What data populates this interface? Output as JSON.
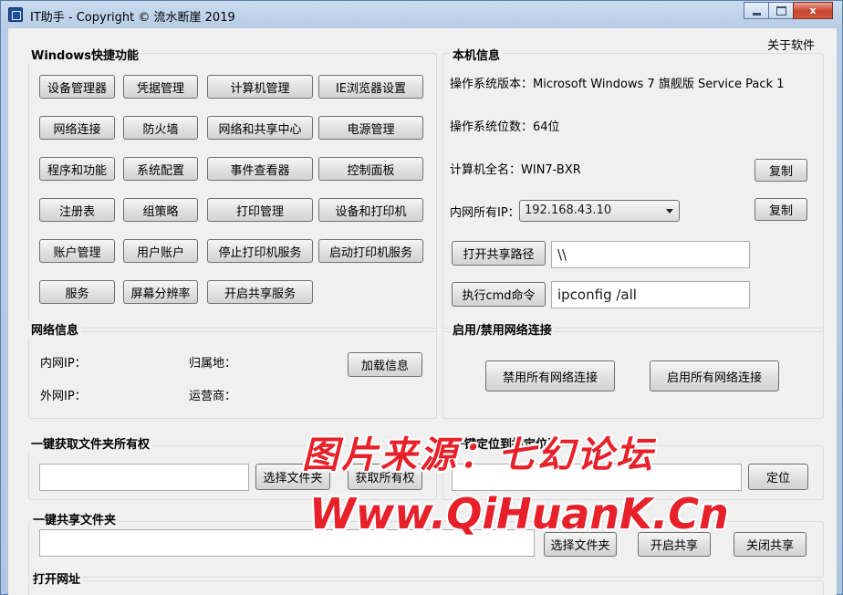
{
  "window": {
    "title": "IT助手 - Copyright © 流水断崖 2019",
    "close_glyph": "x"
  },
  "about_link": "关于软件",
  "shortcuts": {
    "title": "Windows快捷功能",
    "buttons": [
      "设备管理器",
      "凭据管理",
      "计算机管理",
      "IE浏览器设置",
      "网络连接",
      "防火墙",
      "网络和共享中心",
      "电源管理",
      "程序和功能",
      "系统配置",
      "事件查看器",
      "控制面板",
      "注册表",
      "组策略",
      "打印管理",
      "设备和打印机",
      "账户管理",
      "用户账户",
      "停止打印机服务",
      "启动打印机服务",
      "服务",
      "屏幕分辨率",
      "开启共享服务"
    ]
  },
  "local_info": {
    "title": "本机信息",
    "os_version": "操作系统版本：Microsoft Windows 7 旗舰版  Service Pack 1",
    "os_bits": "操作系统位数：64位",
    "computer_name": "计算机全名：WIN7-BXR",
    "copy_label": "复制",
    "lan_ip_label": "内网所有IP：",
    "lan_ip_value": "192.168.43.10",
    "open_share_label": "打开共享路径",
    "share_path": "\\\\",
    "run_cmd_label": "执行cmd命令",
    "cmd_value": "ipconfig /all"
  },
  "net_info": {
    "title": "网络信息",
    "lan_ip": "内网IP：",
    "wan_ip": "外网IP：",
    "location": "归属地：",
    "isp": "运营商：",
    "load_label": "加载信息"
  },
  "net_toggle": {
    "title": "启用/禁用网络连接",
    "disable_label": "禁用所有网络连接",
    "enable_label": "启用所有网络连接"
  },
  "ownership": {
    "title": "一键获取文件夹所有权",
    "select_label": "选择文件夹",
    "take_label": "获取所有权"
  },
  "locate": {
    "title": "一键定位到指定位置",
    "locate_label": "定位"
  },
  "share": {
    "title": "一键共享文件夹",
    "select_label": "选择文件夹",
    "open_label": "开启共享",
    "close_label": "关闭共享"
  },
  "open_url": {
    "title": "打开网址"
  },
  "watermark": {
    "line1": "图片来源：七幻论坛",
    "line2": "Www.QiHuanK.Cn"
  }
}
